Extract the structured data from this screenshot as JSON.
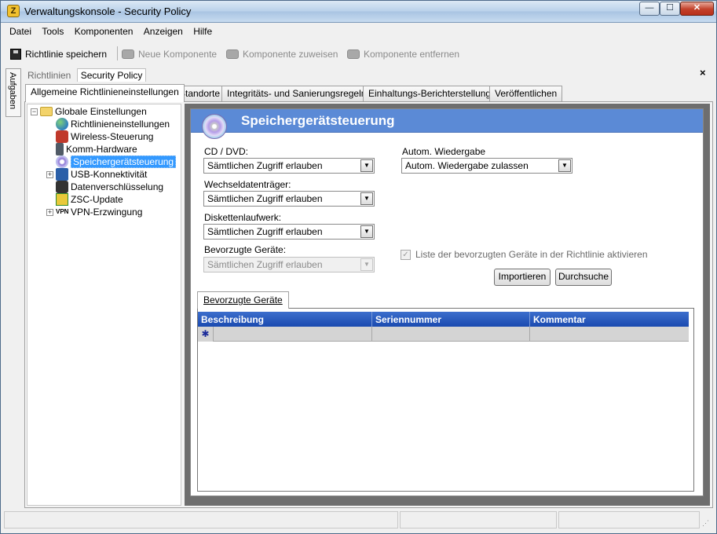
{
  "window": {
    "title": "Verwaltungskonsole - Security Policy",
    "min_label": "—",
    "max_label": "☐",
    "close_label": "✕"
  },
  "menu": [
    "Datei",
    "Tools",
    "Komponenten",
    "Anzeigen",
    "Hilfe"
  ],
  "toolbar": {
    "save": "Richtlinie speichern",
    "new_component": "Neue Komponente",
    "assign_component": "Komponente zuweisen",
    "remove_component": "Komponente entfernen"
  },
  "side_strip": "Aufgaben",
  "subtabs": {
    "inactive": "Richtlinien",
    "active": "Security Policy"
  },
  "close_x": "×",
  "tabs": [
    "Allgemeine Richtlinieneinstellungen",
    "Standorte",
    "Integritäts- und Sanierungsregeln",
    "Einhaltungs-Berichterstellung",
    "Veröffentlichen"
  ],
  "tree": {
    "root": "Globale Einstellungen",
    "expander_minus": "−",
    "expander_plus": "+",
    "vpn_icon_text": "VPN",
    "items": [
      "Richtlinieneinstellungen",
      "Wireless-Steuerung",
      "Komm-Hardware",
      "Speichergerätsteuerung",
      "USB-Konnektivität",
      "Datenverschlüsselung",
      "ZSC-Update",
      "VPN-Erzwingung"
    ]
  },
  "panel": {
    "title": "Speichergerätsteuerung",
    "cd_label": "CD / DVD:",
    "cd_value": "Sämtlichen Zugriff erlauben",
    "removable_label": "Wechseldatenträger:",
    "removable_value": "Sämtlichen Zugriff erlauben",
    "floppy_label": "Diskettenlaufwerk:",
    "floppy_value": "Sämtlichen Zugriff erlauben",
    "preferred_label": "Bevorzugte Geräte:",
    "preferred_value": "Sämtlichen Zugriff erlauben",
    "autorun_label": "Autom. Wiedergabe",
    "autorun_value": "Autom. Wiedergabe zulassen",
    "checkbox_label": "Liste der bevorzugten Geräte in der Richtlinie aktivieren",
    "checkbox_mark": "✓",
    "arrow": "▼",
    "import_button": "Importieren",
    "browse_button": "Durchsuche"
  },
  "grid": {
    "tab": "Bevorzugte Geräte",
    "columns": [
      "Beschreibung",
      "Seriennummer",
      "Kommentar"
    ],
    "new_row_marker": "✱"
  }
}
